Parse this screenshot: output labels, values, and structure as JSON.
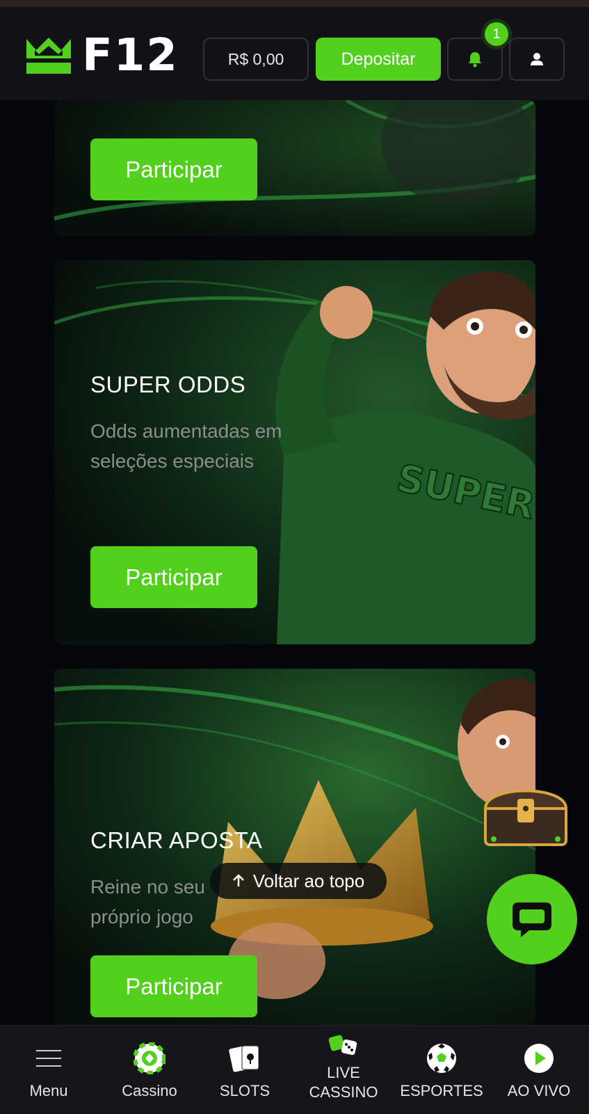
{
  "header": {
    "logo_text": "F12",
    "balance": "R$ 0,00",
    "deposit_label": "Depositar",
    "notification_count": "1",
    "icons": {
      "bell": "bell-icon",
      "user": "user-icon"
    }
  },
  "cards": [
    {
      "button_label": "Participar"
    },
    {
      "title": "SUPER ODDS",
      "description": "Odds aumentadas em seleções especiais",
      "button_label": "Participar",
      "art_text": "SUPER ODDS"
    },
    {
      "title": "CRIAR APOSTA",
      "description": "Reine no seu próprio jogo",
      "button_label": "Participar"
    }
  ],
  "back_to_top": "Voltar ao topo",
  "bottom_nav": [
    {
      "label": "Menu",
      "icon": "hamburger-icon"
    },
    {
      "label": "Cassino",
      "icon": "casino-chip-icon"
    },
    {
      "label": "SLOTS",
      "icon": "playing-cards-icon"
    },
    {
      "label": "LIVE CASSINO",
      "icon": "dice-icon"
    },
    {
      "label": "ESPORTES",
      "icon": "soccer-ball-icon"
    },
    {
      "label": "AO VIVO",
      "icon": "play-icon"
    }
  ],
  "colors": {
    "accent": "#53d01e",
    "background": "#06070c",
    "header": "#111217"
  }
}
